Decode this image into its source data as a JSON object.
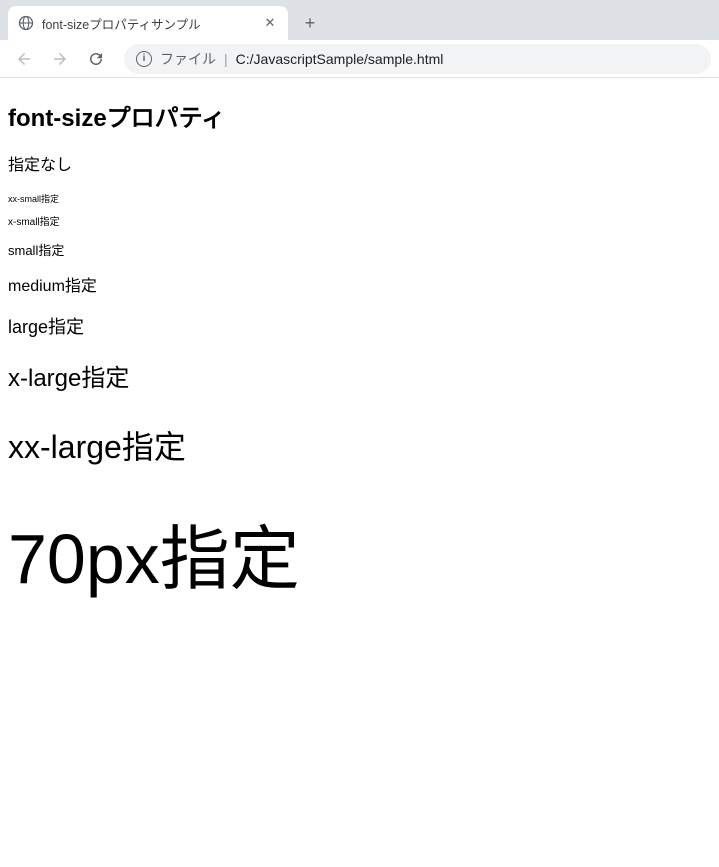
{
  "browser": {
    "tab_title": "font-sizeプロパティサンプル",
    "address_prefix": "ファイル",
    "address_path": "C:/JavascriptSample/sample.html"
  },
  "page": {
    "heading": "font-sizeプロパティ",
    "samples": {
      "none": "指定なし",
      "xxsmall": "xx-small指定",
      "xsmall": "x-small指定",
      "small": "small指定",
      "medium": "medium指定",
      "large": "large指定",
      "xlarge": "x-large指定",
      "xxlarge": "xx-large指定",
      "px70": "70px指定"
    }
  }
}
